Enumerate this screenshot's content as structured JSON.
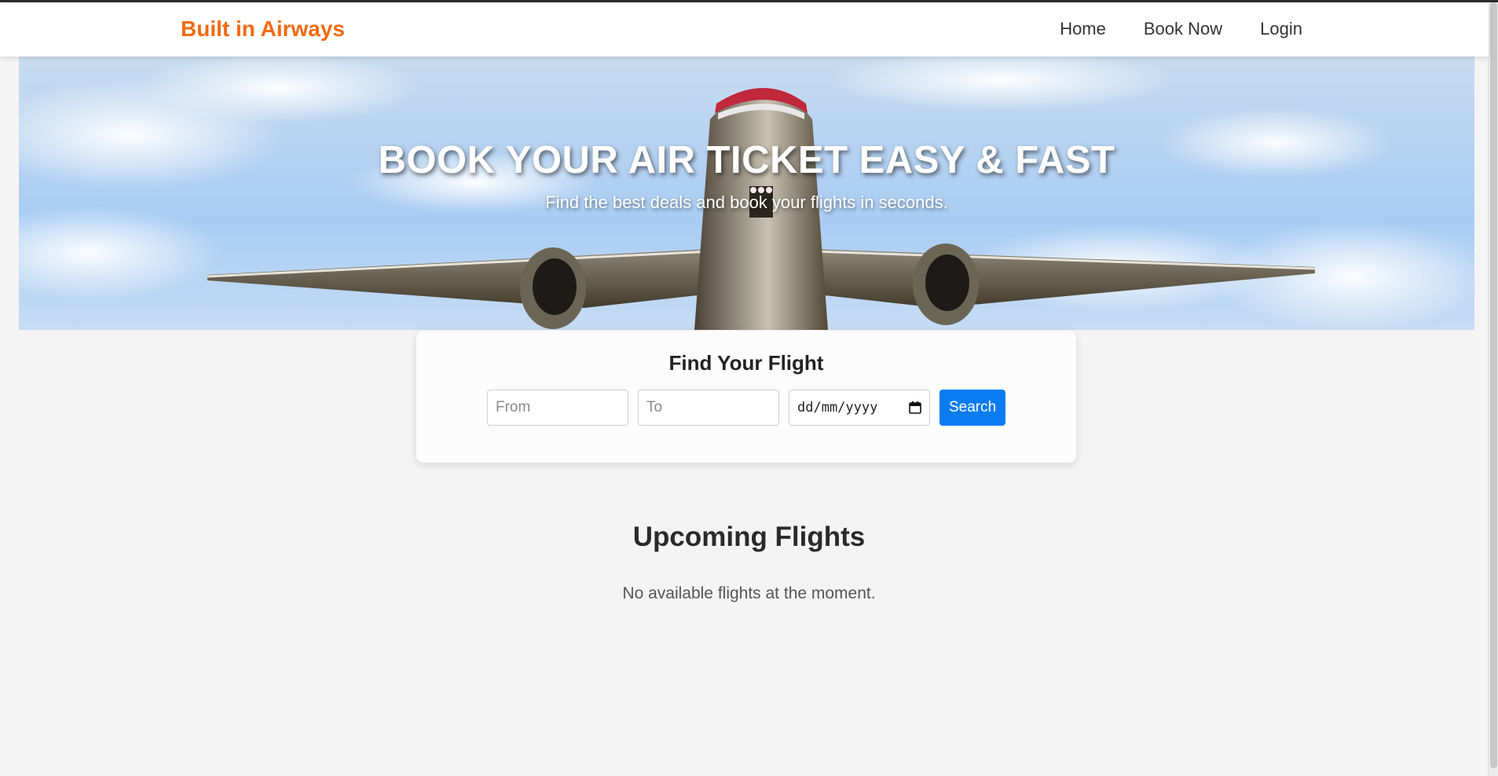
{
  "header": {
    "logo": "Built in Airways",
    "nav": [
      "Home",
      "Book Now",
      "Login"
    ]
  },
  "hero": {
    "title": "BOOK YOUR AIR TICKET EASY & FAST",
    "subtitle": "Find the best deals and book your flights in seconds."
  },
  "search": {
    "title": "Find Your Flight",
    "from_placeholder": "From",
    "to_placeholder": "To",
    "date_placeholder": "dd/mm/yyyy",
    "button_label": "Search"
  },
  "upcoming": {
    "title": "Upcoming Flights",
    "empty_message": "No available flights at the moment."
  },
  "colors": {
    "brand": "#f26a10",
    "accent": "#0a7cf2"
  },
  "icons": {
    "date": "calendar-icon"
  }
}
